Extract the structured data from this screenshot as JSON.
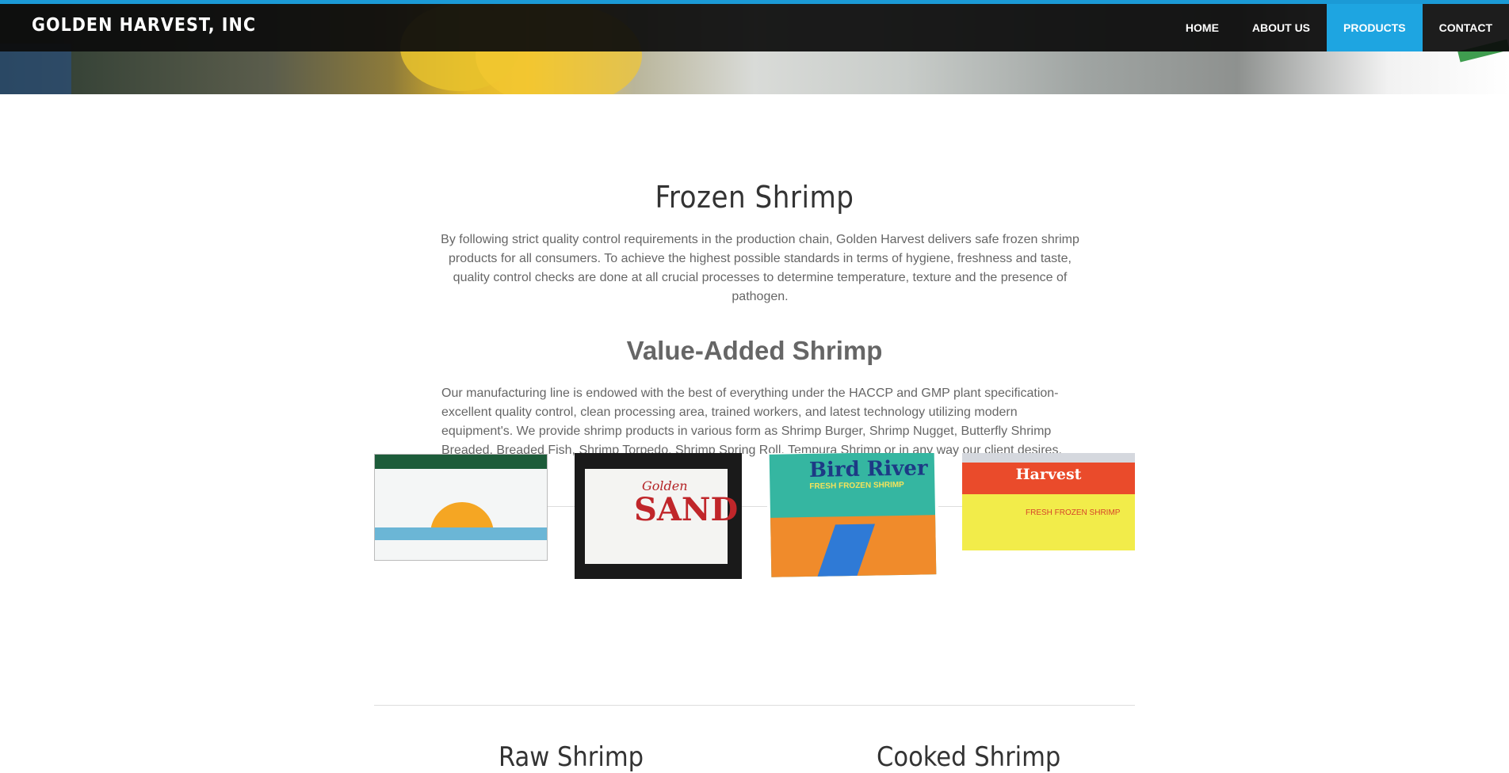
{
  "header": {
    "brand": "GOLDEN HARVEST, INC",
    "nav": [
      {
        "label": "HOME",
        "active": false
      },
      {
        "label": "ABOUT US",
        "active": false
      },
      {
        "label": "PRODUCTS",
        "active": true
      },
      {
        "label": "CONTACT",
        "active": false
      }
    ],
    "accent_color": "#1ea5e1"
  },
  "main": {
    "title": "Frozen Shrimp",
    "intro": "By following strict quality control requirements in the production chain, Golden Harvest delivers safe frozen shrimp products for all consumers. To achieve the highest possible standards in terms of hygiene, freshness and taste, quality control checks are done at all crucial processes to determine temperature, texture and the presence of pathogen.",
    "value_added": {
      "title": "Value-Added Shrimp",
      "text": "Our manufacturing line is endowed with the best of everything under the HACCP and GMP plant specification-excellent quality control, clean processing area, trained workers, and latest technology utilizing modern equipment's. We provide shrimp products in various form as Shrimp Burger, Shrimp Nugget, Butterfly Shrimp Breaded, Breaded Fish, Shrimp Torpedo, Shrimp Spring Roll, Tempura Shrimp or in any way our client desires."
    },
    "gallery": [
      {
        "name": "sunrise-brand-box"
      },
      {
        "name": "golden-sand-box",
        "label_small": "Golden",
        "label_big": "SAND"
      },
      {
        "name": "bird-river-box",
        "label_big": "Bird River",
        "label_small": "FRESH FROZEN SHRIMP"
      },
      {
        "name": "harvest-box",
        "label_big": "Harvest",
        "label_small": "FRESH FROZEN SHRIMP"
      }
    ],
    "sections": [
      {
        "title": "Raw Shrimp"
      },
      {
        "title": "Cooked Shrimp"
      }
    ]
  }
}
